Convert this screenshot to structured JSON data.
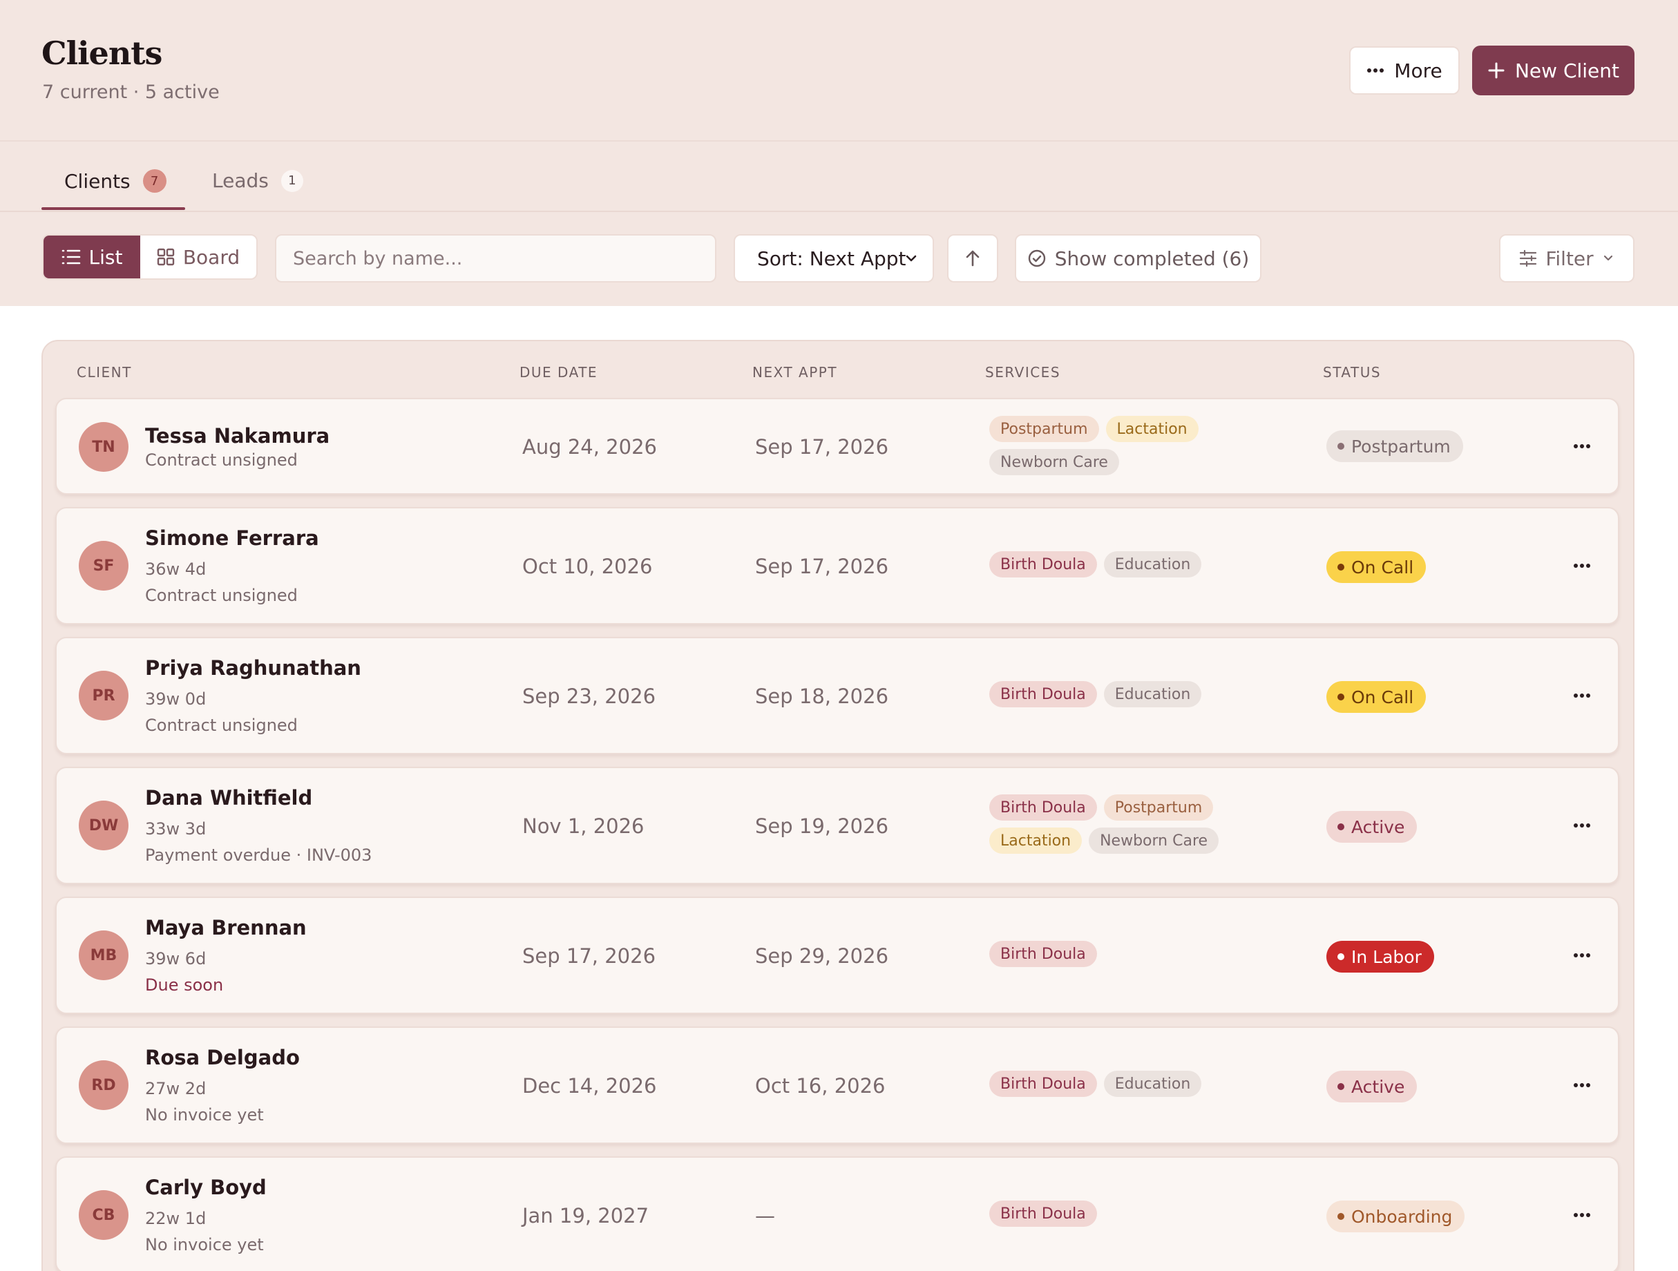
{
  "header": {
    "title": "Clients",
    "subtitle": "7 current · 5 active",
    "more_label": "More",
    "new_client_label": "New Client"
  },
  "tabs": [
    {
      "label": "Clients",
      "count": "7",
      "active": true
    },
    {
      "label": "Leads",
      "count": "1",
      "active": false
    }
  ],
  "toolbar": {
    "view_list_label": "List",
    "view_board_label": "Board",
    "search_placeholder": "Search by name...",
    "sort_label": "Sort: Next Appt",
    "show_completed_label": "Show completed (6)",
    "filter_label": "Filter"
  },
  "table": {
    "columns": [
      "CLIENT",
      "DUE DATE",
      "NEXT APPT",
      "SERVICES",
      "STATUS"
    ],
    "rows": [
      {
        "initials": "TN",
        "name": "Tessa Nakamura",
        "meta": "",
        "note": "Contract unsigned",
        "due_date": "Aug 24, 2026",
        "next_appt": "Sep 17, 2026",
        "services": [
          "Postpartum",
          "Lactation",
          "Newborn Care"
        ],
        "status": "Postpartum"
      },
      {
        "initials": "SF",
        "name": "Simone Ferrara",
        "meta": "36w 4d",
        "note": "Contract unsigned",
        "due_date": "Oct 10, 2026",
        "next_appt": "Sep 17, 2026",
        "services": [
          "Birth Doula",
          "Education"
        ],
        "status": "On Call"
      },
      {
        "initials": "PR",
        "name": "Priya Raghunathan",
        "meta": "39w 0d",
        "note": "Contract unsigned",
        "due_date": "Sep 23, 2026",
        "next_appt": "Sep 18, 2026",
        "services": [
          "Birth Doula",
          "Education"
        ],
        "status": "On Call"
      },
      {
        "initials": "DW",
        "name": "Dana Whitfield",
        "meta": "33w 3d",
        "note": "Payment overdue · INV-003",
        "due_date": "Nov 1, 2026",
        "next_appt": "Sep 19, 2026",
        "services": [
          "Birth Doula",
          "Postpartum",
          "Lactation",
          "Newborn Care"
        ],
        "status": "Active"
      },
      {
        "initials": "MB",
        "name": "Maya Brennan",
        "meta": "39w 6d",
        "note": "Due soon",
        "due_date": "Sep 17, 2026",
        "next_appt": "Sep 29, 2026",
        "services": [
          "Birth Doula"
        ],
        "status": "In Labor"
      },
      {
        "initials": "RD",
        "name": "Rosa Delgado",
        "meta": "27w 2d",
        "note": "No invoice yet",
        "due_date": "Dec 14, 2026",
        "next_appt": "Oct 16, 2026",
        "services": [
          "Birth Doula",
          "Education"
        ],
        "status": "Active"
      },
      {
        "initials": "CB",
        "name": "Carly Boyd",
        "meta": "22w 1d",
        "note": "No invoice yet",
        "due_date": "Jan 19, 2027",
        "next_appt": "—",
        "services": [
          "Birth Doula"
        ],
        "status": "Onboarding"
      }
    ]
  },
  "colors": {
    "brand": "#7f3b4f",
    "page_bg": "#f3e6e1",
    "status_on_call": "#fad24a",
    "status_in_labor": "#cc2a2a",
    "status_active": "#f1d6d3"
  },
  "icons": [
    "dots-horizontal-icon",
    "plus-icon",
    "list-icon",
    "grid-icon",
    "chevron-down-icon",
    "arrow-up-icon",
    "check-circle-icon",
    "sliders-icon"
  ]
}
